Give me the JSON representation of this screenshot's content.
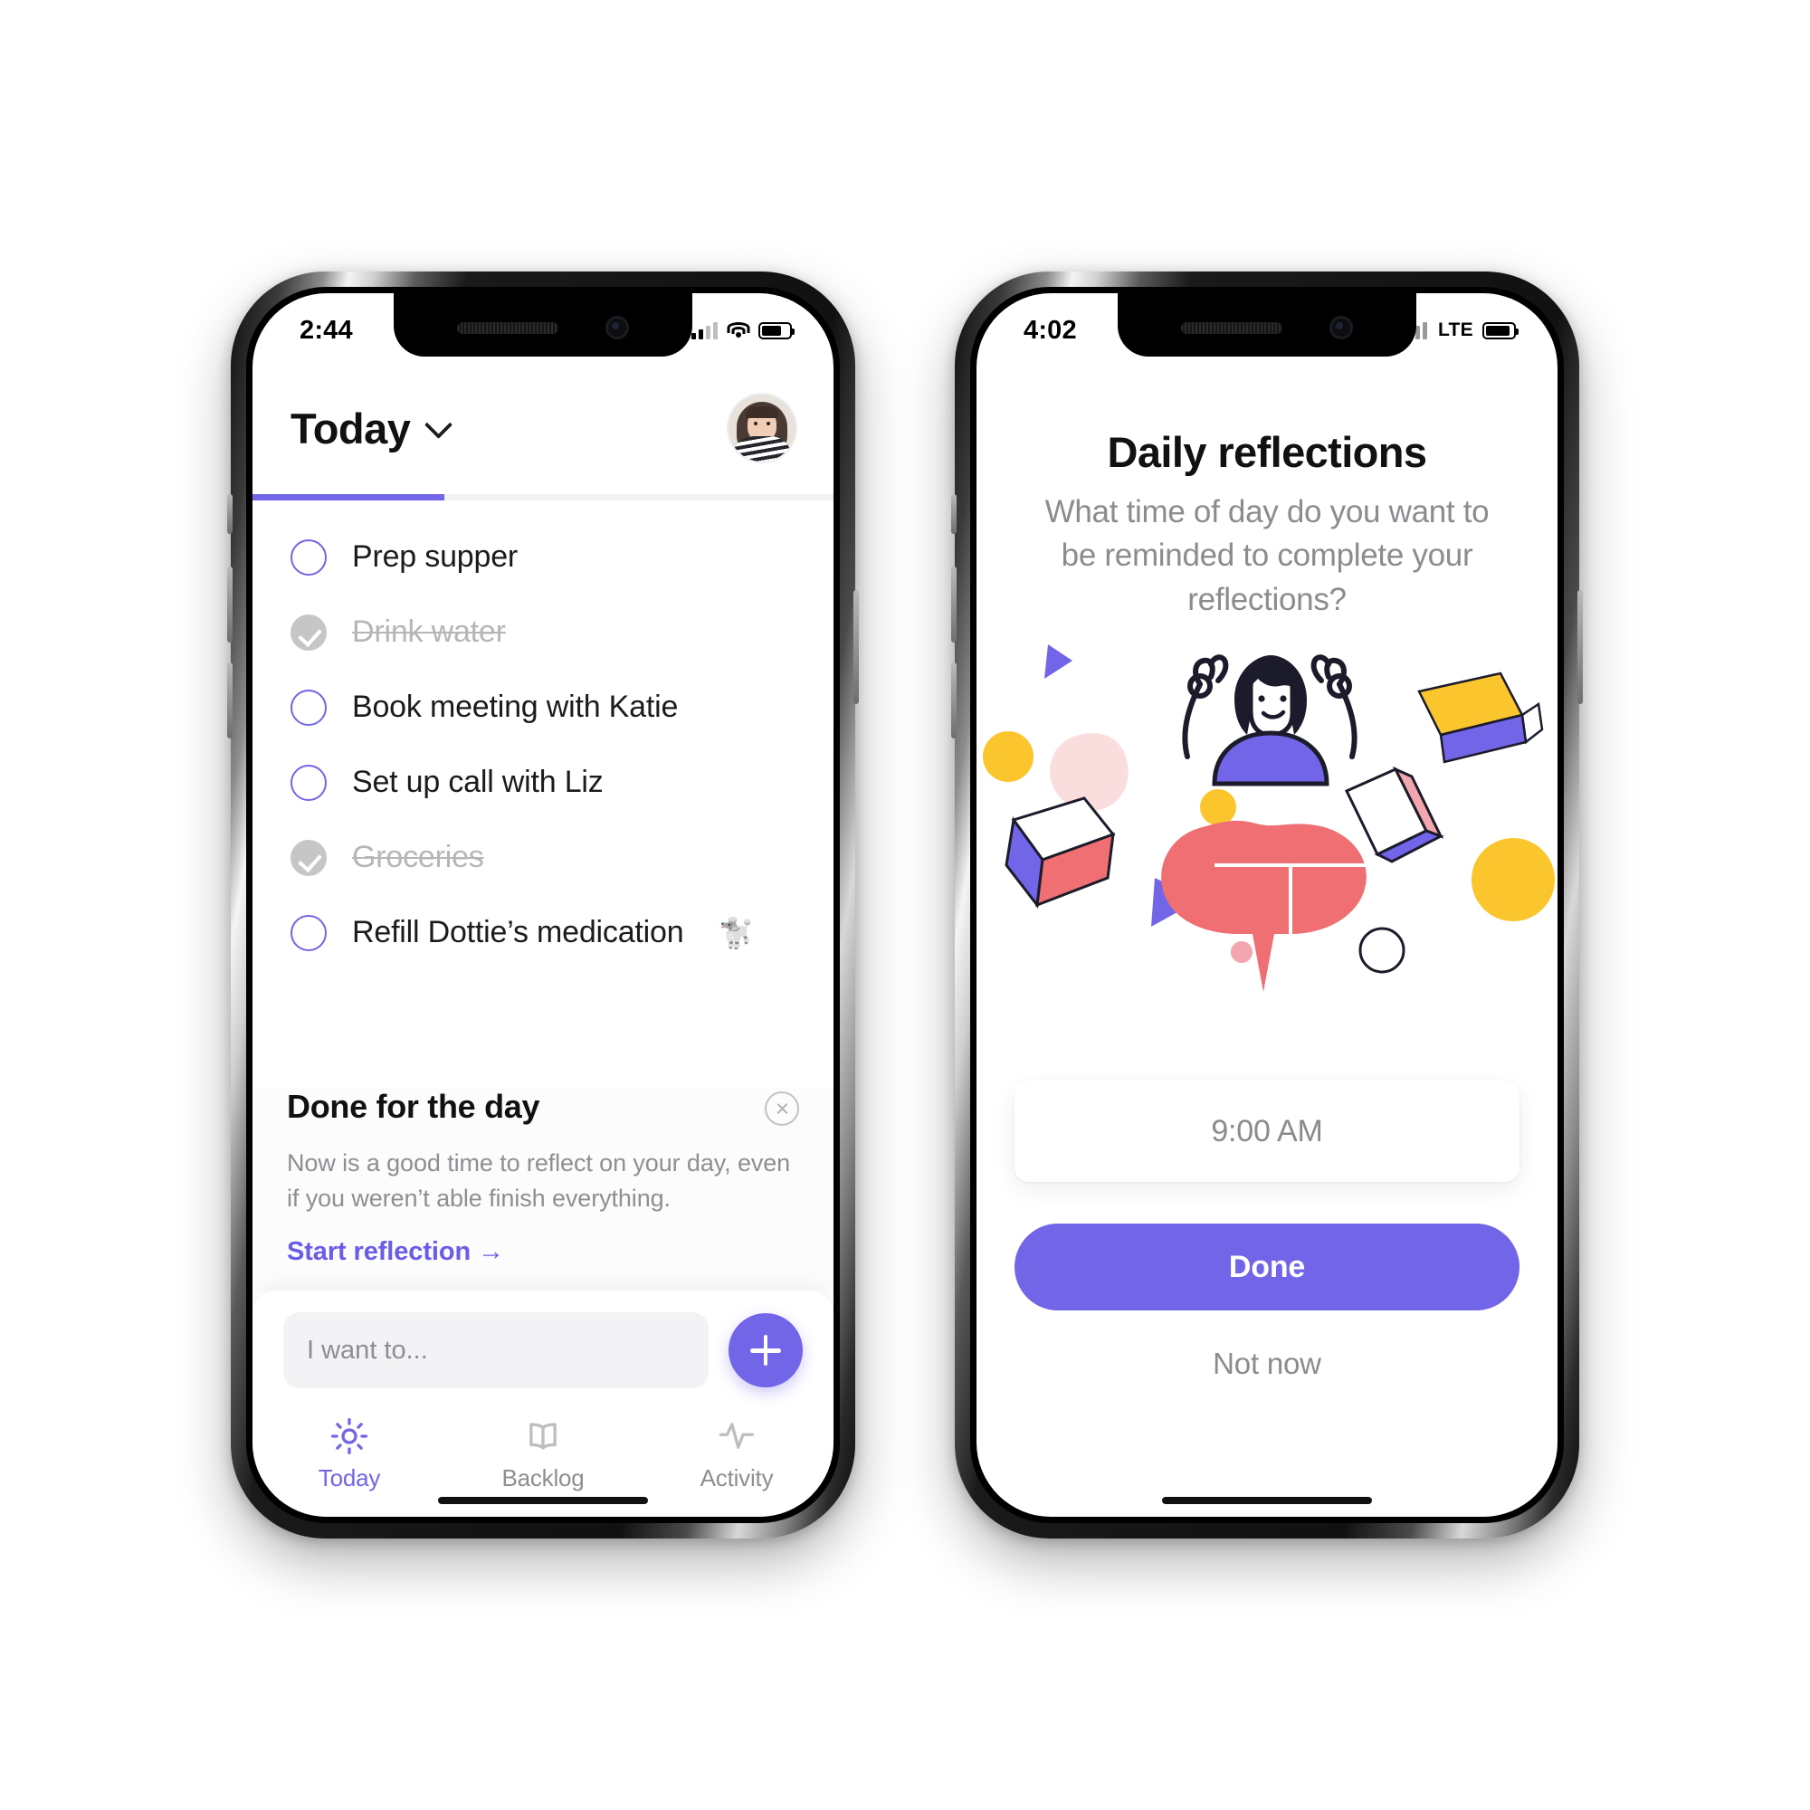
{
  "theme": {
    "accent": "#7265e8",
    "accent_dark": "#6a5ce8",
    "muted_text": "#8e8e93",
    "done_gray": "#c6c6c9",
    "bg": "#ffffff"
  },
  "phone_left": {
    "status": {
      "time": "2:44",
      "signal_icon": "cellular-signal-icon",
      "wifi_icon": "wifi-icon",
      "battery_icon": "battery-icon"
    },
    "header": {
      "title": "Today",
      "chevron_icon": "chevron-down-icon",
      "avatar_icon": "user-avatar"
    },
    "progress": {
      "percent": 33
    },
    "tasks": [
      {
        "label": "Prep supper",
        "completed": false,
        "emoji": ""
      },
      {
        "label": "Drink water",
        "completed": true,
        "emoji": ""
      },
      {
        "label": "Book meeting with Katie",
        "completed": false,
        "emoji": ""
      },
      {
        "label": "Set up call with Liz",
        "completed": false,
        "emoji": ""
      },
      {
        "label": "Groceries",
        "completed": true,
        "emoji": ""
      },
      {
        "label": "Refill Dottie’s medication",
        "completed": false,
        "emoji": "🐩"
      }
    ],
    "done_card": {
      "title": "Done for the day",
      "close_icon": "close-icon",
      "description": "Now is a good time to reflect on your day, even if you weren’t able finish everything.",
      "link_label": "Start reflection →"
    },
    "composer": {
      "placeholder": "I want to...",
      "value": "",
      "add_icon": "plus-icon"
    },
    "tabs": [
      {
        "label": "Today",
        "icon": "sun-icon",
        "active": true
      },
      {
        "label": "Backlog",
        "icon": "book-icon",
        "active": false
      },
      {
        "label": "Activity",
        "icon": "pulse-icon",
        "active": false
      }
    ]
  },
  "phone_right": {
    "status": {
      "time": "4:02",
      "signal_icon": "cellular-signal-icon",
      "network_label": "LTE",
      "battery_icon": "battery-icon"
    },
    "title": "Daily reflections",
    "question": "What time of day do you want to be reminded to complete your reflections?",
    "illustration_name": "person-celebrating-with-shapes-illustration",
    "time_value": "9:00 AM",
    "primary_button": "Done",
    "secondary_button": "Not now"
  }
}
